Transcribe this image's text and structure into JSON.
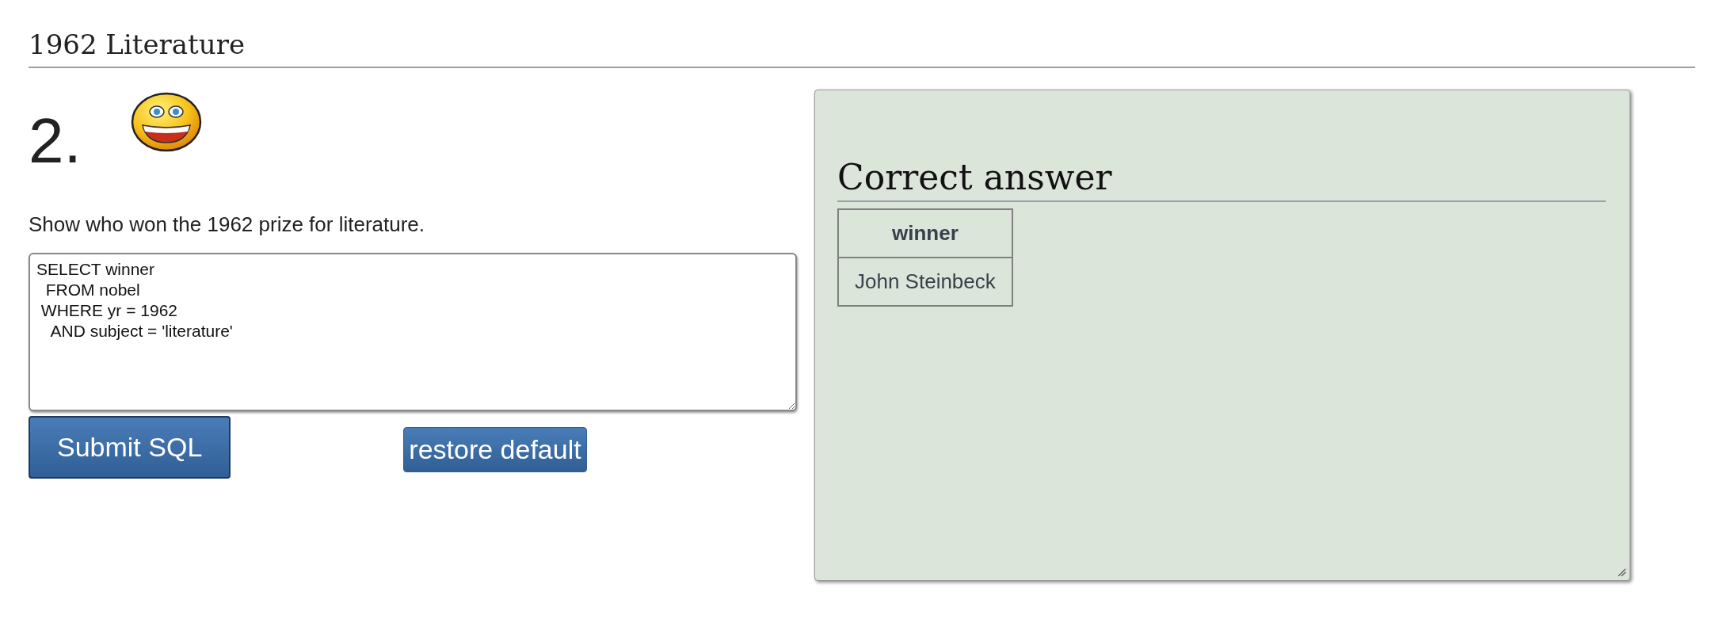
{
  "page_title": "1962 Literature",
  "question": {
    "number": "2.",
    "prompt": "Show who won the 1962 prize for literature.",
    "sql": "SELECT winner\n  FROM nobel\n WHERE yr = 1962\n   AND subject = 'literature'"
  },
  "buttons": [
    {
      "label": "Submit SQL",
      "kind": "primary"
    },
    {
      "label": "restore default",
      "kind": "secondary"
    }
  ],
  "answer_panel": {
    "heading": "Correct answer",
    "table": {
      "columns": [
        "winner"
      ],
      "rows": [
        [
          "John Steinbeck"
        ]
      ]
    }
  }
}
